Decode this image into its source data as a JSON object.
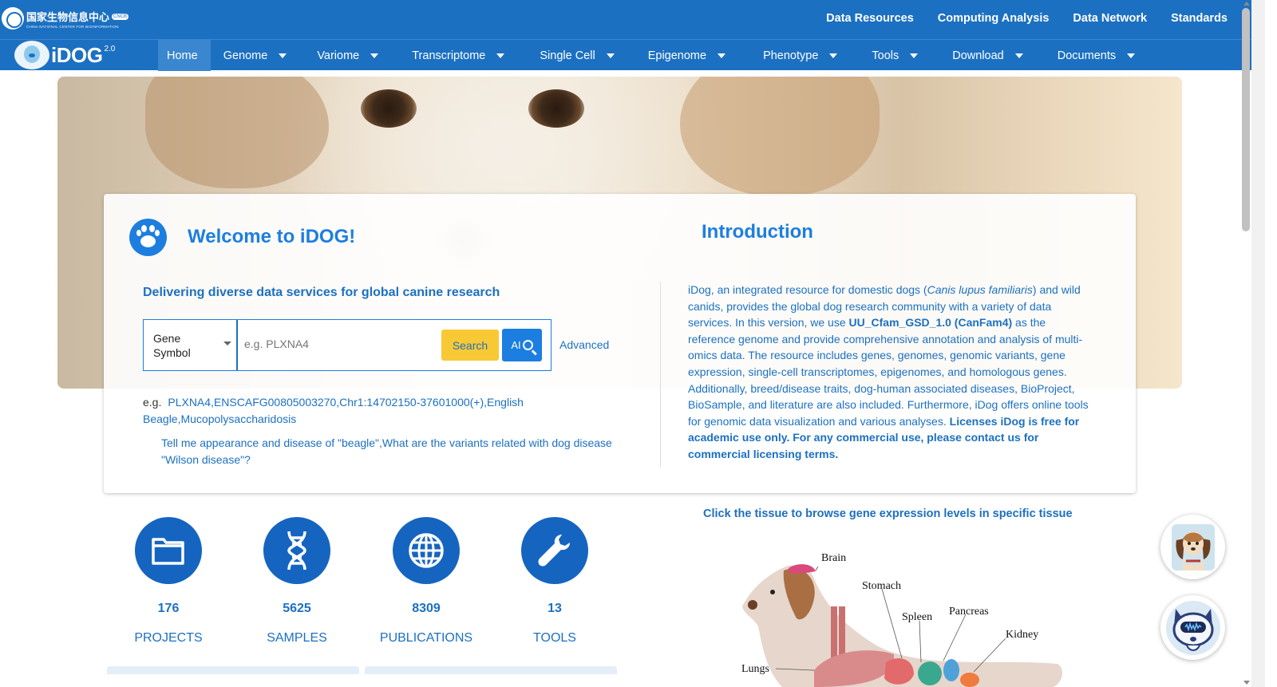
{
  "topbar": {
    "org_name": "国家生物信息中心",
    "org_badge": "CNCB",
    "org_name_en": "CHINA NATIONAL CENTER FOR BIOINFORMATION",
    "links": [
      "Data Resources",
      "Computing Analysis",
      "Data Network",
      "Standards"
    ]
  },
  "brand": {
    "name": "iDOG",
    "version": "2.0"
  },
  "nav": {
    "items": [
      {
        "label": "Home",
        "active": true,
        "dropdown": false
      },
      {
        "label": "Genome",
        "dropdown": true
      },
      {
        "label": "Variome",
        "dropdown": true
      },
      {
        "label": "Transcriptome",
        "dropdown": true
      },
      {
        "label": "Single Cell",
        "dropdown": true
      },
      {
        "label": "Epigenome",
        "dropdown": true
      },
      {
        "label": "Phenotype",
        "dropdown": true
      },
      {
        "label": "Tools",
        "dropdown": true
      },
      {
        "label": "Download",
        "dropdown": true
      },
      {
        "label": "Documents",
        "dropdown": true
      }
    ]
  },
  "welcome": {
    "title": "Welcome to iDOG!",
    "subtitle": "Delivering diverse data services for global canine research",
    "search": {
      "type_selected": "Gene Symbol",
      "placeholder": "e.g. PLXNA4",
      "search_label": "Search",
      "ai_label": "AI",
      "advanced_label": "Advanced"
    },
    "examples_prefix": "e.g.",
    "examples": [
      "PLXNA4",
      "ENSCAFG00805003270",
      "Chr1:14702150-37601000(+)",
      "English Beagle",
      "Mucopolysaccharidosis"
    ],
    "ai_examples": [
      "Tell me appearance and disease of \"beagle\"",
      "What are the variants related with dog disease \"Wilson disease\"?"
    ]
  },
  "introduction": {
    "title": "Introduction",
    "p1": "iDog, an integrated resource for domestic dogs (",
    "species": "Canis lupus familiaris",
    "p2": ") and wild canids, provides the global dog research community with a variety of data services. In this version, we use ",
    "genome": "UU_Cfam_GSD_1.0 (CanFam4)",
    "p3": " as the reference genome and provide comprehensive annotation and analysis of multi-omics data. The resource includes genes, genomes, genomic variants, gene expression, single-cell transcriptomes, epigenomes, and homologous genes. Additionally, breed/disease traits, dog-human associated diseases, BioProject, BioSample, and literature are also included. Furthermore, iDog offers online tools for genomic data visualization and various analyses. ",
    "license": "Licenses iDog is free for academic use only. For any commercial use, please contact us for commercial licensing terms."
  },
  "stats": [
    {
      "value": "176",
      "label": "PROJECTS",
      "icon": "folder-icon"
    },
    {
      "value": "5625",
      "label": "SAMPLES",
      "icon": "dna-icon"
    },
    {
      "value": "8309",
      "label": "PUBLICATIONS",
      "icon": "globe-icon"
    },
    {
      "value": "13",
      "label": "TOOLS",
      "icon": "wrench-icon"
    }
  ],
  "tissue_map": {
    "title": "Click the tissue to browse gene expression levels in specific tissue",
    "labels": {
      "brain": "Brain",
      "stomach": "Stomach",
      "spleen": "Spleen",
      "pancreas": "Pancreas",
      "kidney": "Kidney",
      "lungs": "Lungs"
    }
  },
  "colors": {
    "primary": "#1c70c2",
    "accent": "#1c7ee0",
    "search_button": "#f9c935"
  }
}
